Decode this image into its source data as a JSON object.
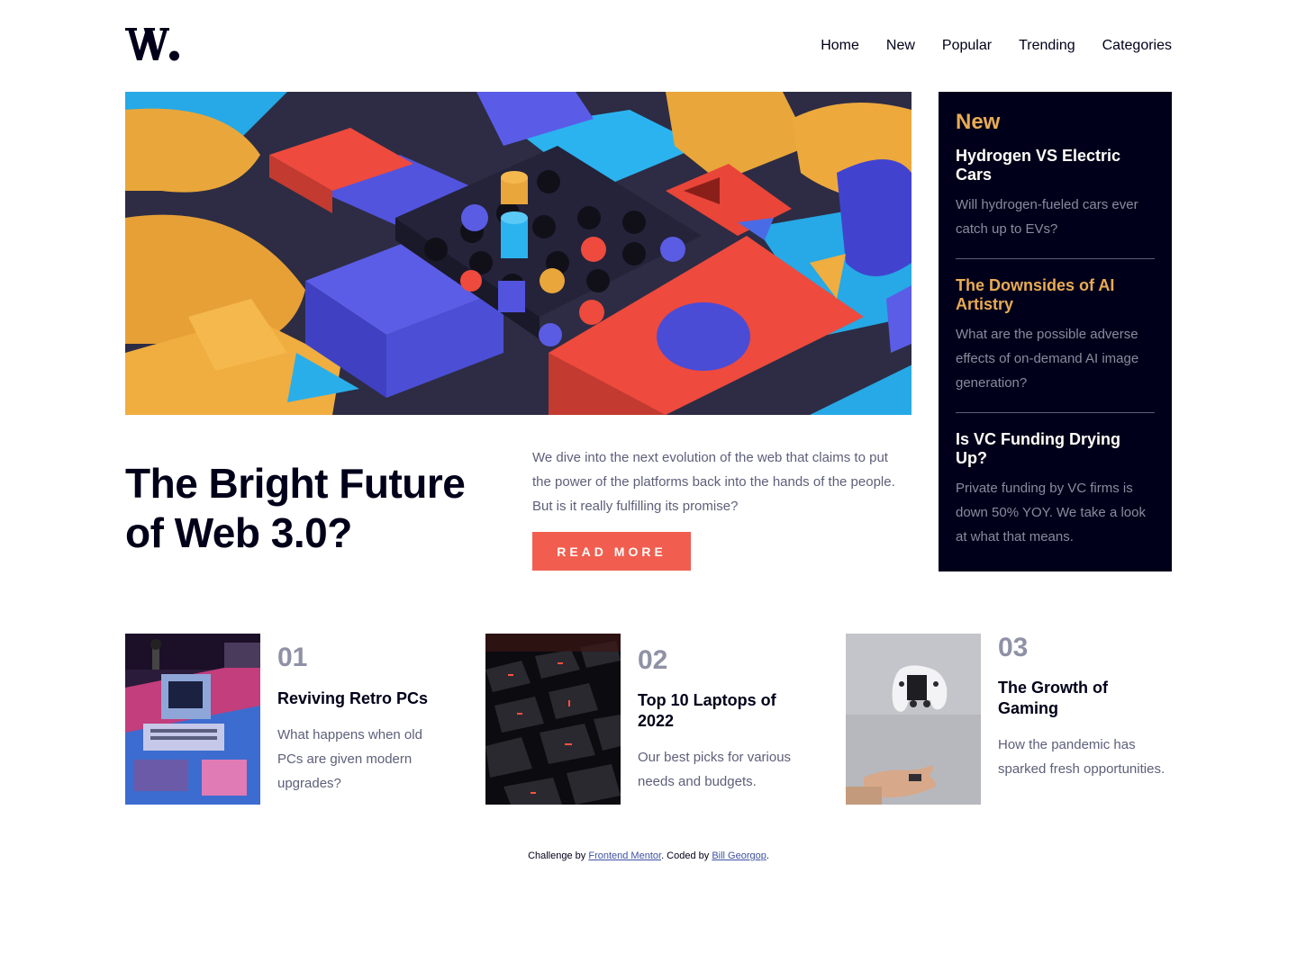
{
  "brand": {
    "logo_icon": "w-logo-icon"
  },
  "nav": {
    "items": [
      "Home",
      "New",
      "Popular",
      "Trending",
      "Categories"
    ]
  },
  "hero": {
    "image_icon": "abstract-blocks-image",
    "title_line1": "The Bright Future",
    "title_line2": "of Web 3.0?",
    "description": "We dive into the next evolution of the web that claims to put the power of the platforms back into the hands of the people. But is it really fulfilling its promise?",
    "button_label": "READ MORE"
  },
  "new_panel": {
    "heading": "New",
    "items": [
      {
        "title": "Hydrogen VS Electric Cars",
        "description": "Will hydrogen-fueled cars ever catch up to EVs?"
      },
      {
        "title": "The Downsides of AI Artistry",
        "description": "What are the possible adverse effects of on-demand AI image generation?"
      },
      {
        "title": "Is VC Funding Drying Up?",
        "description": "Private funding by VC firms is down 50% YOY. We take a look at what that means."
      }
    ]
  },
  "cards": [
    {
      "number": "01",
      "title": "Reviving Retro PCs",
      "description": "What happens when old PCs are given modern upgrades?",
      "image_icon": "retro-pc-image"
    },
    {
      "number": "02",
      "title": "Top 10 Laptops of 2022",
      "description": "Our best picks for various needs and budgets.",
      "image_icon": "laptop-keyboard-image"
    },
    {
      "number": "03",
      "title": "The Growth of Gaming",
      "description": "How the pandemic has sparked fresh opportunities.",
      "image_icon": "gamepad-image"
    }
  ],
  "attribution": {
    "prefix": "Challenge by",
    "link1": "Frontend Mentor",
    "middle": ". Coded by",
    "link2": "Bill Georgop",
    "suffix": "."
  },
  "colors": {
    "accent_red": "#f15e50",
    "accent_orange": "#e9ab53",
    "dark_navy": "#00001a",
    "grayish_blue": "#5d5f79",
    "off_white": "#fffdfa"
  }
}
